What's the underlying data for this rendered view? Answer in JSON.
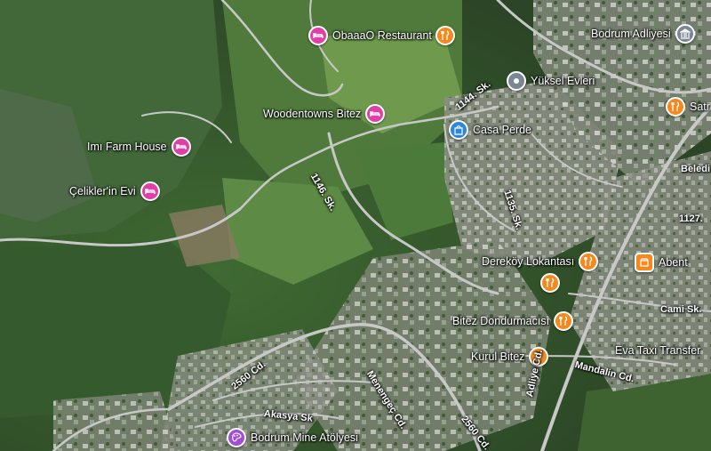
{
  "map": {
    "view": "satellite",
    "colors": {
      "lodging": "#e23fa4",
      "food": "#f5891e",
      "landmark": "#7b8794",
      "shopping": "#2d86e0",
      "arts": "#a44dd6",
      "road": "#c8c8c8"
    },
    "places": [
      {
        "id": "obaaao",
        "name": "ObaaaO Restaurant",
        "category": "lodging",
        "icon": "bed-icon",
        "extra_icon": "restaurant-icon"
      },
      {
        "id": "bodrum-adliyesi",
        "name": "Bodrum Adliyesi",
        "category": "landmark",
        "icon": "building-icon"
      },
      {
        "id": "yuksel-evleri",
        "name": "Yüksel Evleri",
        "category": "landmark",
        "icon": "location-dot-icon"
      },
      {
        "id": "satr",
        "name": "Satr",
        "category": "food",
        "icon": "restaurant-icon"
      },
      {
        "id": "woodentowns",
        "name": "Woodentowns Bitez",
        "category": "lodging",
        "icon": "bed-icon"
      },
      {
        "id": "casa-perde",
        "name": "Casa Perde",
        "category": "shopping",
        "icon": "shopping-bag-icon"
      },
      {
        "id": "imi-farm",
        "name": "Imı Farm House",
        "category": "lodging",
        "icon": "bed-icon"
      },
      {
        "id": "celikler",
        "name": "Çelikler'in Evi",
        "category": "lodging",
        "icon": "bed-icon"
      },
      {
        "id": "derekoy",
        "name": "Dereköy Lokantası",
        "category": "food",
        "icon": "restaurant-icon"
      },
      {
        "id": "abent",
        "name": "Abent",
        "category": "food",
        "icon": "shop-icon"
      },
      {
        "id": "bitez-dondurmacisi",
        "name": "Bitez Dondurmacısı",
        "category": "food",
        "icon": "restaurant-icon"
      },
      {
        "id": "eva-taxi",
        "name": "Eva Taxi Transfer",
        "category": "transport",
        "icon": "none"
      },
      {
        "id": "kurul-bitez",
        "name": "Kurul Bitez",
        "category": "food",
        "icon": "restaurant-icon"
      },
      {
        "id": "bodrum-mine",
        "name": "Bodrum Mine Atölyesi",
        "category": "arts",
        "icon": "palette-icon"
      }
    ],
    "streets": {
      "s1144": "1144. Sk.",
      "s1146": "1146. Sk.",
      "s1135": "1135. Sk.",
      "s1127": "1127.",
      "beledi": "Beledi",
      "cami": "Cami Sk.",
      "mandalin": "Mandalin Cd.",
      "c2560a": "2560 Cd.",
      "c2560b": "2560 Cd.",
      "menengec": "Menengeç Cd.",
      "akasya": "Akasya Sk",
      "adliye": "Adliye Cd."
    }
  }
}
